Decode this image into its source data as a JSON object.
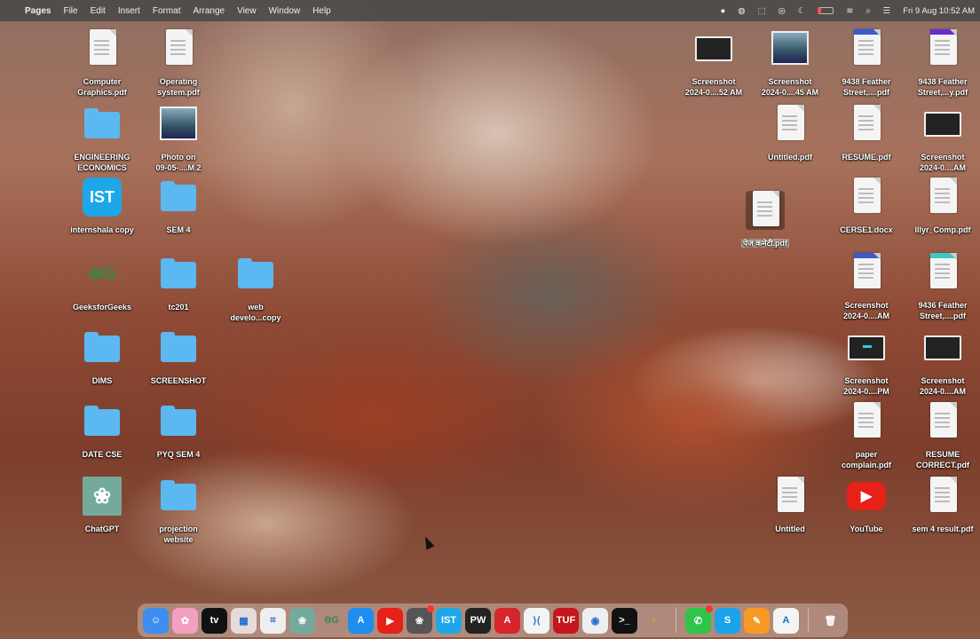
{
  "menubar": {
    "app_name": "Pages",
    "items": [
      "File",
      "Edit",
      "Insert",
      "Format",
      "Arrange",
      "View",
      "Window",
      "Help"
    ],
    "datetime": "Fri 9 Aug  10:52 AM"
  },
  "desktop_left": [
    {
      "label": "Computer\nGraphics.pdf",
      "kind": "pdf"
    },
    {
      "label": "Operating\nsystem.pdf",
      "kind": "pdf"
    },
    {
      "label": "ENGINEERING\nECONOMICS",
      "kind": "folder"
    },
    {
      "label": "Photo on\n09-05-....M 2",
      "kind": "photo"
    },
    {
      "label": "internshala copy",
      "kind": "app-ist"
    },
    {
      "label": "SEM 4",
      "kind": "folder"
    },
    {
      "label": "GeeksforGeeks",
      "kind": "app-gfg"
    },
    {
      "label": "tc201",
      "kind": "folder"
    },
    {
      "label": "web\ndevelo...copy",
      "kind": "folder"
    },
    {
      "label": "DIMS",
      "kind": "folder"
    },
    {
      "label": "SCREENSHOT",
      "kind": "folder"
    },
    {
      "label": "DATE CSE",
      "kind": "folder"
    },
    {
      "label": "PYQ SEM 4",
      "kind": "folder"
    },
    {
      "label": "ChatGPT",
      "kind": "app-chatgpt"
    },
    {
      "label": "projection\nwebsite",
      "kind": "folder"
    }
  ],
  "desktop_right": [
    {
      "label": "Screenshot\n2024-0....52 AM",
      "kind": "shot"
    },
    {
      "label": "Screenshot\n2024-0....45 AM",
      "kind": "photo"
    },
    {
      "label": "9438 Feather\nStreet,....pdf",
      "kind": "pdf-blue"
    },
    {
      "label": "9438 Feather\nStreet,...y.pdf",
      "kind": "pdf-purple"
    },
    {
      "label": "Untitled.pdf",
      "kind": "pdf"
    },
    {
      "label": "RESUME.pdf",
      "kind": "pdf"
    },
    {
      "label": "Screenshot\n2024-0....AM",
      "kind": "shot"
    },
    {
      "label": "पेज कमेटी.pdf",
      "kind": "pdf",
      "selected": true
    },
    {
      "label": "CERSE1.docx",
      "kind": "pdf"
    },
    {
      "label": "lllyr_Comp.pdf",
      "kind": "pdf"
    },
    {
      "label": "Screenshot\n2024-0....AM",
      "kind": "pdf-blue"
    },
    {
      "label": "9436 Feather\nStreet,....pdf",
      "kind": "pdf-teal"
    },
    {
      "label": "Screenshot\n2024-0....PM",
      "kind": "shot-cyan"
    },
    {
      "label": "Screenshot\n2024-0....AM",
      "kind": "shot"
    },
    {
      "label": "paper\ncomplain.pdf",
      "kind": "pdf"
    },
    {
      "label": "RESUME\nCORRECT.pdf",
      "kind": "pdf"
    },
    {
      "label": "Untitled",
      "kind": "pdf"
    },
    {
      "label": "YouTube",
      "kind": "app-youtube"
    },
    {
      "label": "sem 4 result.pdf",
      "kind": "pdf"
    }
  ],
  "dock": [
    {
      "name": "finder",
      "glyph": "☺",
      "color": "#3d8ef0"
    },
    {
      "name": "photos",
      "glyph": "✿",
      "color": "#f3a0c0"
    },
    {
      "name": "apple-tv",
      "glyph": "tv",
      "color": "#111"
    },
    {
      "name": "launchpad",
      "glyph": "▦",
      "color": "#e6dada"
    },
    {
      "name": "screenshot",
      "glyph": "⌗",
      "color": "#eee"
    },
    {
      "name": "chatgpt",
      "glyph": "❀",
      "color": "#74aa9c"
    },
    {
      "name": "geeksforgeeks",
      "glyph": "ƏG",
      "color": "transparent"
    },
    {
      "name": "app-store",
      "glyph": "A",
      "color": "#1e8df0"
    },
    {
      "name": "youtube",
      "glyph": "▶",
      "color": "#e62117"
    },
    {
      "name": "chatgpt-web",
      "glyph": "❀",
      "color": "#555",
      "badge": true
    },
    {
      "name": "internshala",
      "glyph": "IST",
      "color": "#1ea7e8"
    },
    {
      "name": "physics-wallah",
      "glyph": "PW",
      "color": "#222"
    },
    {
      "name": "acrobat",
      "glyph": "A",
      "color": "#d6262b"
    },
    {
      "name": "vs-code",
      "glyph": "⟩⟨",
      "color": "#f4f4f4"
    },
    {
      "name": "tuf",
      "glyph": "TUF",
      "color": "#c4161c"
    },
    {
      "name": "chrome",
      "glyph": "◉",
      "color": "#eee"
    },
    {
      "name": "terminal",
      "glyph": ">_",
      "color": "#111"
    },
    {
      "name": "sublime",
      "glyph": "‹",
      "color": "transparent"
    },
    {
      "name": "whatsapp",
      "glyph": "✆",
      "color": "#2fc44a",
      "badge": true,
      "sep_before": true
    },
    {
      "name": "skype",
      "glyph": "S",
      "color": "#1aa3e8"
    },
    {
      "name": "pages",
      "glyph": "✎",
      "color": "#f79a24"
    },
    {
      "name": "altstore",
      "glyph": "A",
      "color": "#f4f4f4"
    },
    {
      "name": "trash",
      "glyph": "🗑",
      "color": "transparent",
      "sep_before": true
    }
  ]
}
